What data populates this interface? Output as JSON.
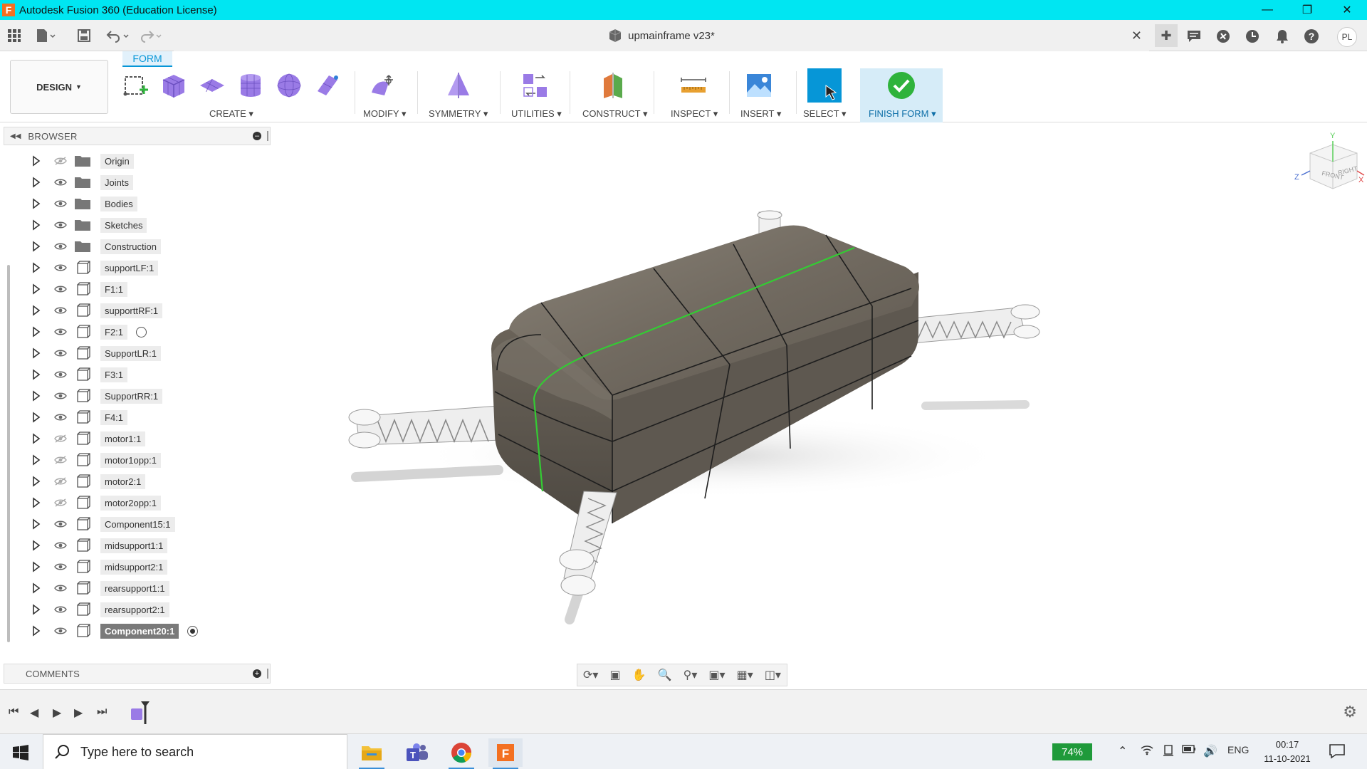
{
  "window": {
    "title": "Autodesk Fusion 360 (Education License)"
  },
  "document": {
    "name": "upmainframe v23*"
  },
  "user": {
    "initials": "PL"
  },
  "workspace": {
    "label": "DESIGN",
    "tab": "FORM"
  },
  "ribbon": {
    "groups": [
      {
        "label": "CREATE"
      },
      {
        "label": "MODIFY"
      },
      {
        "label": "SYMMETRY"
      },
      {
        "label": "UTILITIES"
      },
      {
        "label": "CONSTRUCT"
      },
      {
        "label": "INSPECT"
      },
      {
        "label": "INSERT"
      },
      {
        "label": "SELECT"
      },
      {
        "label": "FINISH FORM"
      }
    ]
  },
  "browser": {
    "title": "BROWSER",
    "items": [
      {
        "label": "Origin",
        "icon": "folder-icon",
        "hidden": true
      },
      {
        "label": "Joints",
        "icon": "folder-icon",
        "hidden": false
      },
      {
        "label": "Bodies",
        "icon": "folder-icon",
        "hidden": false
      },
      {
        "label": "Sketches",
        "icon": "folder-icon",
        "hidden": false
      },
      {
        "label": "Construction",
        "icon": "folder-icon",
        "hidden": false
      },
      {
        "label": "supportLF:1",
        "icon": "component-icon",
        "hidden": false
      },
      {
        "label": "F1:1",
        "icon": "component-icon",
        "hidden": false
      },
      {
        "label": "supporttRF:1",
        "icon": "component-icon",
        "hidden": false
      },
      {
        "label": "F2:1",
        "icon": "component-icon",
        "hidden": false
      },
      {
        "label": "SupportLR:1",
        "icon": "component-icon",
        "hidden": false
      },
      {
        "label": "F3:1",
        "icon": "component-icon",
        "hidden": false
      },
      {
        "label": "SupportRR:1",
        "icon": "component-icon",
        "hidden": false
      },
      {
        "label": "F4:1",
        "icon": "component-icon",
        "hidden": false
      },
      {
        "label": "motor1:1",
        "icon": "component-icon",
        "hidden": true
      },
      {
        "label": "motor1opp:1",
        "icon": "component-icon",
        "hidden": true
      },
      {
        "label": "motor2:1",
        "icon": "component-icon",
        "hidden": true
      },
      {
        "label": "motor2opp:1",
        "icon": "component-icon",
        "hidden": true
      },
      {
        "label": "Component15:1",
        "icon": "component-icon",
        "hidden": false
      },
      {
        "label": "midsupport1:1",
        "icon": "component-icon",
        "hidden": false
      },
      {
        "label": "midsupport2:1",
        "icon": "component-icon",
        "hidden": false
      },
      {
        "label": "rearsupport1:1",
        "icon": "component-icon",
        "hidden": false
      },
      {
        "label": "rearsupport2:1",
        "icon": "component-icon",
        "hidden": false
      },
      {
        "label": "Component20:1",
        "icon": "component-icon",
        "hidden": false,
        "active": true
      }
    ]
  },
  "comments": {
    "title": "COMMENTS"
  },
  "viewcube": {
    "face_front": "FRONT",
    "face_right": "RIGHT",
    "axis_x": "X",
    "axis_y": "Y",
    "axis_z": "Z"
  },
  "taskbar": {
    "search_placeholder": "Type here to search",
    "battery": "74%",
    "language": "ENG",
    "time": "00:17",
    "date": "11-10-2021"
  },
  "colors": {
    "titlebar": "#00e6f2",
    "accent": "#0696d7",
    "form_purple": "#9a7be6",
    "body_gray": "#6b655d",
    "edge_green": "#33cc33"
  }
}
